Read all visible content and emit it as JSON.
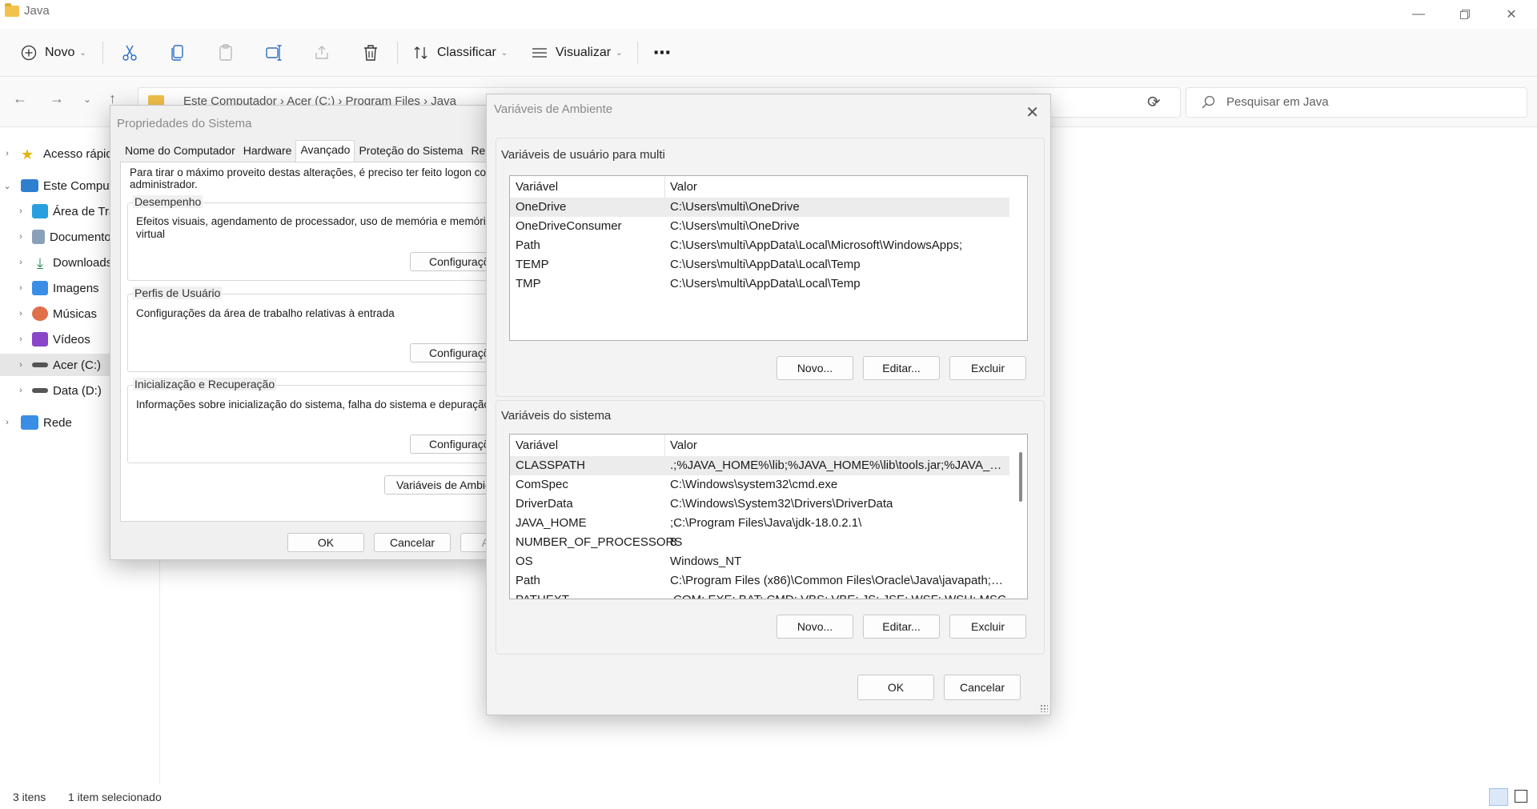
{
  "window": {
    "title": "Java",
    "controls": [
      "minimize-icon",
      "restore-icon",
      "close-icon"
    ]
  },
  "toolbar": {
    "new_label": "Novo",
    "sort_label": "Classificar",
    "view_label": "Visualizar",
    "more_label": "⋯"
  },
  "address": {
    "crumbs": "Este Computador  ›  Acer (C:)  ›  Program Files  ›  Java",
    "search_placeholder": "Pesquisar em Java"
  },
  "nav": {
    "items": [
      {
        "label": "Acesso rápido"
      },
      {
        "label": "Este Computador"
      },
      {
        "label": "Área de Trabalho"
      },
      {
        "label": "Documentos"
      },
      {
        "label": "Downloads"
      },
      {
        "label": "Imagens"
      },
      {
        "label": "Músicas"
      },
      {
        "label": "Vídeos"
      },
      {
        "label": "Acer (C:)"
      },
      {
        "label": "Data (D:)"
      },
      {
        "label": "Rede"
      }
    ]
  },
  "status": {
    "items": "3 itens",
    "selected": "1 item selecionado"
  },
  "sysprops": {
    "title": "Propriedades do Sistema",
    "tabs": [
      "Nome do Computador",
      "Hardware",
      "Avançado",
      "Proteção do Sistema",
      "Remoto"
    ],
    "admin_note_1": "Para tirar o máximo proveito destas alterações, é preciso ter feito logon como",
    "admin_note_2": "administrador.",
    "perf": {
      "label": "Desempenho",
      "desc_1": "Efeitos visuais, agendamento de processador, uso de memória e memória",
      "desc_2": "virtual",
      "button": "Configurações..."
    },
    "profiles": {
      "label": "Perfis de Usuário",
      "desc": "Configurações da área de trabalho relativas à entrada",
      "button": "Configurações..."
    },
    "startup": {
      "label": "Inicialização e Recuperação",
      "desc": "Informações sobre inicialização do sistema, falha do sistema e depuração",
      "button": "Configurações..."
    },
    "env_button": "Variáveis de Ambiente...",
    "ok": "OK",
    "cancel": "Cancelar",
    "apply": "Aplicar"
  },
  "envvars": {
    "title": "Variáveis de Ambiente",
    "user_section": "Variáveis de usuário para multi",
    "col_var": "Variável",
    "col_val": "Valor",
    "user_vars": [
      {
        "name": "OneDrive",
        "value": "C:\\Users\\multi\\OneDrive"
      },
      {
        "name": "OneDriveConsumer",
        "value": "C:\\Users\\multi\\OneDrive"
      },
      {
        "name": "Path",
        "value": "C:\\Users\\multi\\AppData\\Local\\Microsoft\\WindowsApps;"
      },
      {
        "name": "TEMP",
        "value": "C:\\Users\\multi\\AppData\\Local\\Temp"
      },
      {
        "name": "TMP",
        "value": "C:\\Users\\multi\\AppData\\Local\\Temp"
      }
    ],
    "system_section": "Variáveis do sistema",
    "system_vars": [
      {
        "name": "CLASSPATH",
        "value": ".;%JAVA_HOME%\\lib;%JAVA_HOME%\\lib\\tools.jar;%JAVA_HO..."
      },
      {
        "name": "ComSpec",
        "value": "C:\\Windows\\system32\\cmd.exe"
      },
      {
        "name": "DriverData",
        "value": "C:\\Windows\\System32\\Drivers\\DriverData"
      },
      {
        "name": "JAVA_HOME",
        "value": ";C:\\Program Files\\Java\\jdk-18.0.2.1\\"
      },
      {
        "name": "NUMBER_OF_PROCESSORS",
        "value": "8"
      },
      {
        "name": "OS",
        "value": "Windows_NT"
      },
      {
        "name": "Path",
        "value": "C:\\Program Files (x86)\\Common Files\\Oracle\\Java\\javapath;C:..."
      },
      {
        "name": "PATHEXT",
        "value": ".COM;.EXE;.BAT;.CMD;.VBS;.VBE;.JS;.JSE;.WSF;.WSH;.MSC"
      }
    ],
    "new": "Novo...",
    "edit": "Editar...",
    "delete": "Excluir",
    "ok": "OK",
    "cancel": "Cancelar"
  }
}
